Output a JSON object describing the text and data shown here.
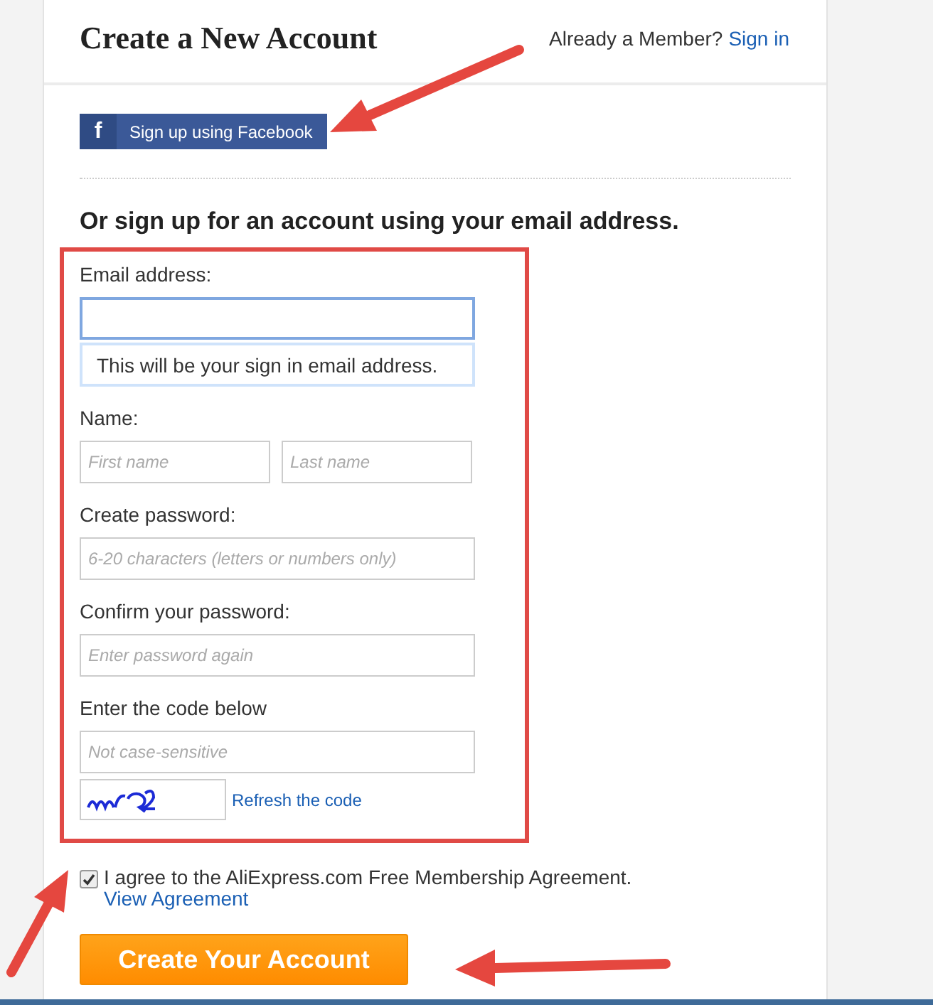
{
  "header": {
    "title": "Create a New Account",
    "member_prompt": "Already a Member?",
    "sign_in_link": "Sign in"
  },
  "facebook_button": {
    "icon": "f",
    "label": "Sign up using Facebook"
  },
  "email_heading": "Or sign up for an account using your email address.",
  "fields": [
    {
      "kind": "single",
      "label": "Email address:",
      "focused": true,
      "hint": "This will be your sign in email address."
    },
    {
      "kind": "pair",
      "label": "Name:",
      "inputs": [
        {
          "placeholder": "First name"
        },
        {
          "placeholder": "Last name"
        }
      ]
    },
    {
      "kind": "single",
      "label": "Create password:",
      "placeholder": "6-20 characters (letters or numbers only)",
      "focused": false
    },
    {
      "kind": "single",
      "label": "Confirm your password:",
      "placeholder": "Enter password again",
      "focused": false
    },
    {
      "kind": "single",
      "label": "Enter the code below",
      "placeholder": "Not case-sensitive",
      "focused": false
    }
  ],
  "captcha": {
    "refresh_link": "Refresh the code"
  },
  "agreement": {
    "checked": true,
    "text": "I agree to the AliExpress.com Free Membership Agreement.",
    "link": "View Agreement"
  },
  "submit_button": "Create Your Account"
}
